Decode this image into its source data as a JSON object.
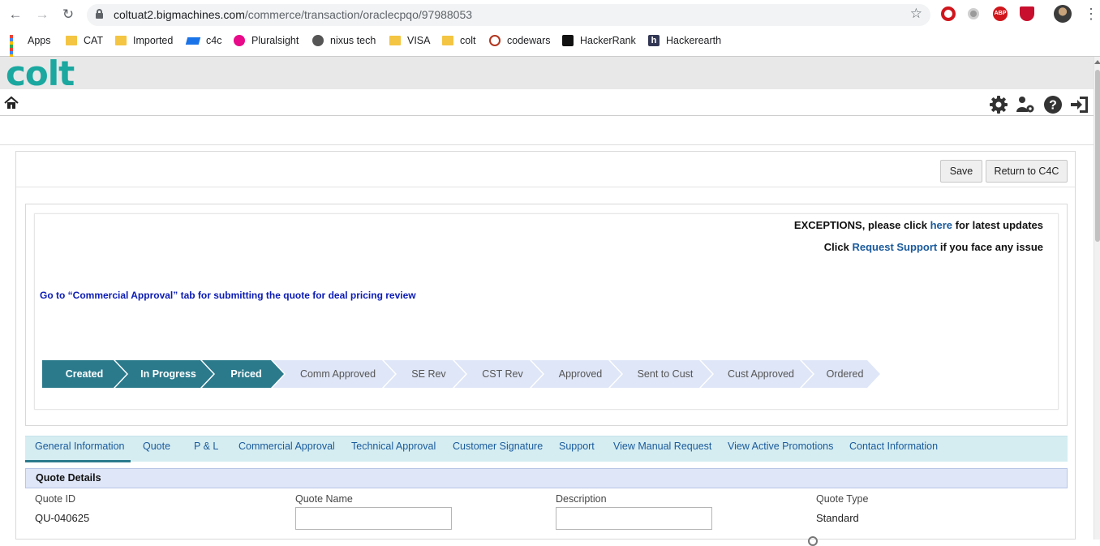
{
  "browser": {
    "url_host": "coltuat2.bigmachines.com",
    "url_path": "/commerce/transaction/oraclecpqo/97988053",
    "bookmarks": [
      {
        "label": "Apps",
        "icon": "apps-grid-icon"
      },
      {
        "label": "CAT",
        "icon": "folder-icon"
      },
      {
        "label": "Imported",
        "icon": "folder-icon"
      },
      {
        "label": "c4c",
        "icon": "sap-icon"
      },
      {
        "label": "Pluralsight",
        "icon": "pluralsight-icon"
      },
      {
        "label": "nixus tech",
        "icon": "globe-icon"
      },
      {
        "label": "VISA",
        "icon": "folder-icon"
      },
      {
        "label": "colt",
        "icon": "folder-icon"
      },
      {
        "label": "codewars",
        "icon": "codewars-icon"
      },
      {
        "label": "HackerRank",
        "icon": "hackerrank-icon"
      },
      {
        "label": "Hackerearth",
        "icon": "hackerearth-icon"
      }
    ],
    "extensions": [
      "opera-icon",
      "circle-extension-icon",
      "adblock-plus-icon",
      "mcafee-icon"
    ],
    "extension_badge": "ABP"
  },
  "app": {
    "logo": "colt",
    "toolbar_icons": [
      "home-icon",
      "settings-icon",
      "user-settings-icon",
      "help-icon",
      "logout-icon"
    ]
  },
  "actions": {
    "save": "Save",
    "return": "Return to C4C"
  },
  "notice": {
    "exceptions_prefix": "EXCEPTIONS, please click ",
    "exceptions_link": "here",
    "exceptions_suffix": " for latest updates",
    "support_prefix": "Click ",
    "support_link": "Request Support",
    "support_suffix": " if you face any issue",
    "goto_text": "Go to “Commercial Approval” tab for submitting the quote for deal pricing review"
  },
  "progress_steps": [
    {
      "label": "Created",
      "done": true
    },
    {
      "label": "In Progress",
      "done": true
    },
    {
      "label": "Priced",
      "done": true
    },
    {
      "label": "Comm Approved",
      "done": false
    },
    {
      "label": "SE Rev",
      "done": false
    },
    {
      "label": "CST Rev",
      "done": false
    },
    {
      "label": "Approved",
      "done": false
    },
    {
      "label": "Sent to Cust",
      "done": false
    },
    {
      "label": "Cust Approved",
      "done": false
    },
    {
      "label": "Ordered",
      "done": false
    }
  ],
  "tabs": [
    {
      "label": "General Information",
      "active": true
    },
    {
      "label": "Quote",
      "active": false
    },
    {
      "label": "P & L",
      "active": false
    },
    {
      "label": "Commercial Approval",
      "active": false
    },
    {
      "label": "Technical Approval",
      "active": false
    },
    {
      "label": "Customer Signature",
      "active": false
    },
    {
      "label": "Support",
      "active": false
    },
    {
      "label": "View Manual Request",
      "active": false
    },
    {
      "label": "View Active Promotions",
      "active": false
    },
    {
      "label": "Contact Information",
      "active": false
    }
  ],
  "quote_details": {
    "title": "Quote Details",
    "fields": {
      "quote_id": {
        "label": "Quote ID",
        "value": "QU-040625"
      },
      "quote_name": {
        "label": "Quote Name",
        "value": ""
      },
      "description": {
        "label": "Description",
        "value": ""
      },
      "quote_type": {
        "label": "Quote Type",
        "value": "Standard"
      }
    }
  },
  "colors": {
    "brand": "#1aa8a0",
    "step_done": "#2b7a8c",
    "step_todo": "#dfe6f7",
    "link": "#1a5a9c"
  }
}
